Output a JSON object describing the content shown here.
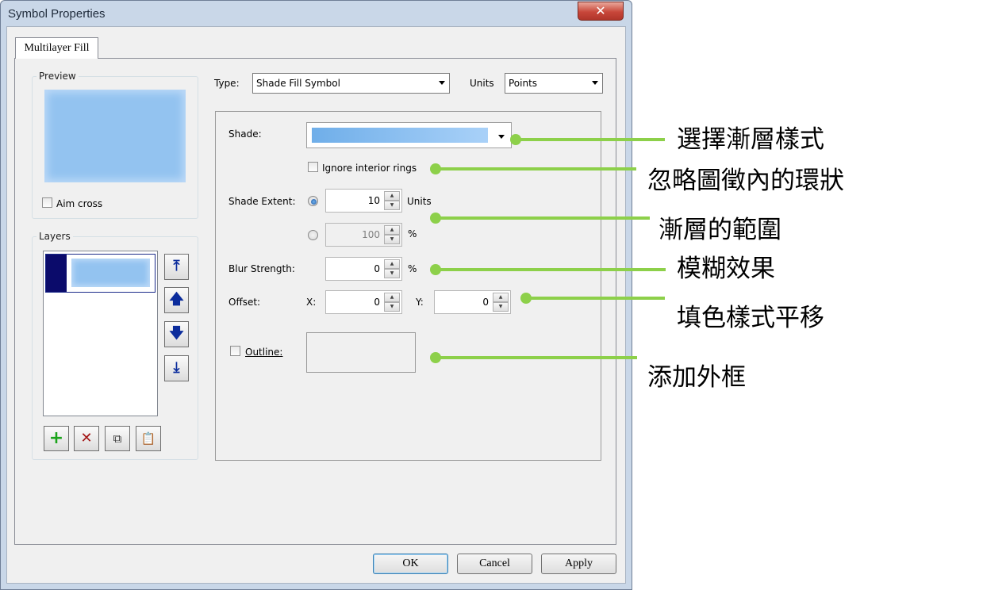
{
  "window": {
    "title": "Symbol Properties",
    "close_glyph": "✕"
  },
  "tabs": [
    {
      "label": "Multilayer Fill",
      "selected": true
    }
  ],
  "preview": {
    "legend": "Preview",
    "aim_cross_label": "Aim cross",
    "aim_cross_checked": false
  },
  "layers": {
    "legend": "Layers",
    "items": [
      {
        "selected": true
      }
    ],
    "move_buttons": [
      "move-to-top-icon",
      "move-up-icon",
      "move-down-icon",
      "move-to-bottom-icon"
    ],
    "tool_buttons": [
      "add-layer-icon",
      "delete-layer-icon",
      "copy-layer-icon",
      "paste-layer-icon"
    ]
  },
  "type": {
    "label": "Type:",
    "value": "Shade Fill Symbol"
  },
  "units": {
    "label": "Units",
    "value": "Points"
  },
  "shade": {
    "label": "Shade:",
    "gradient_from": "#6faee9",
    "gradient_to": "#a9d1f8"
  },
  "ignore_interior": {
    "label": "Ignore interior rings",
    "checked": false
  },
  "shade_extent": {
    "label": "Shade Extent:",
    "units_value": "10",
    "units_label": "Units",
    "units_selected": true,
    "percent_value": "100",
    "percent_label": "%",
    "percent_selected": false
  },
  "blur": {
    "label": "Blur Strength:",
    "value": "0",
    "unit": "%"
  },
  "offset": {
    "label": "Offset:",
    "x_label": "X:",
    "x_value": "0",
    "y_label": "Y:",
    "y_value": "0"
  },
  "outline": {
    "label": "Outline:",
    "checked": false
  },
  "buttons": {
    "ok": "OK",
    "cancel": "Cancel",
    "apply": "Apply"
  },
  "annotations": [
    {
      "text": "選擇漸層樣式"
    },
    {
      "text": "忽略圖徵內的環狀"
    },
    {
      "text": "漸層的範圍"
    },
    {
      "text": "模糊效果"
    },
    {
      "text": "填色樣式平移"
    },
    {
      "text": "添加外框"
    }
  ],
  "colors": {
    "annotation": "#8dd04a",
    "preview_fill": "#93c3f0",
    "layer_marker": "#0b0b6b"
  }
}
